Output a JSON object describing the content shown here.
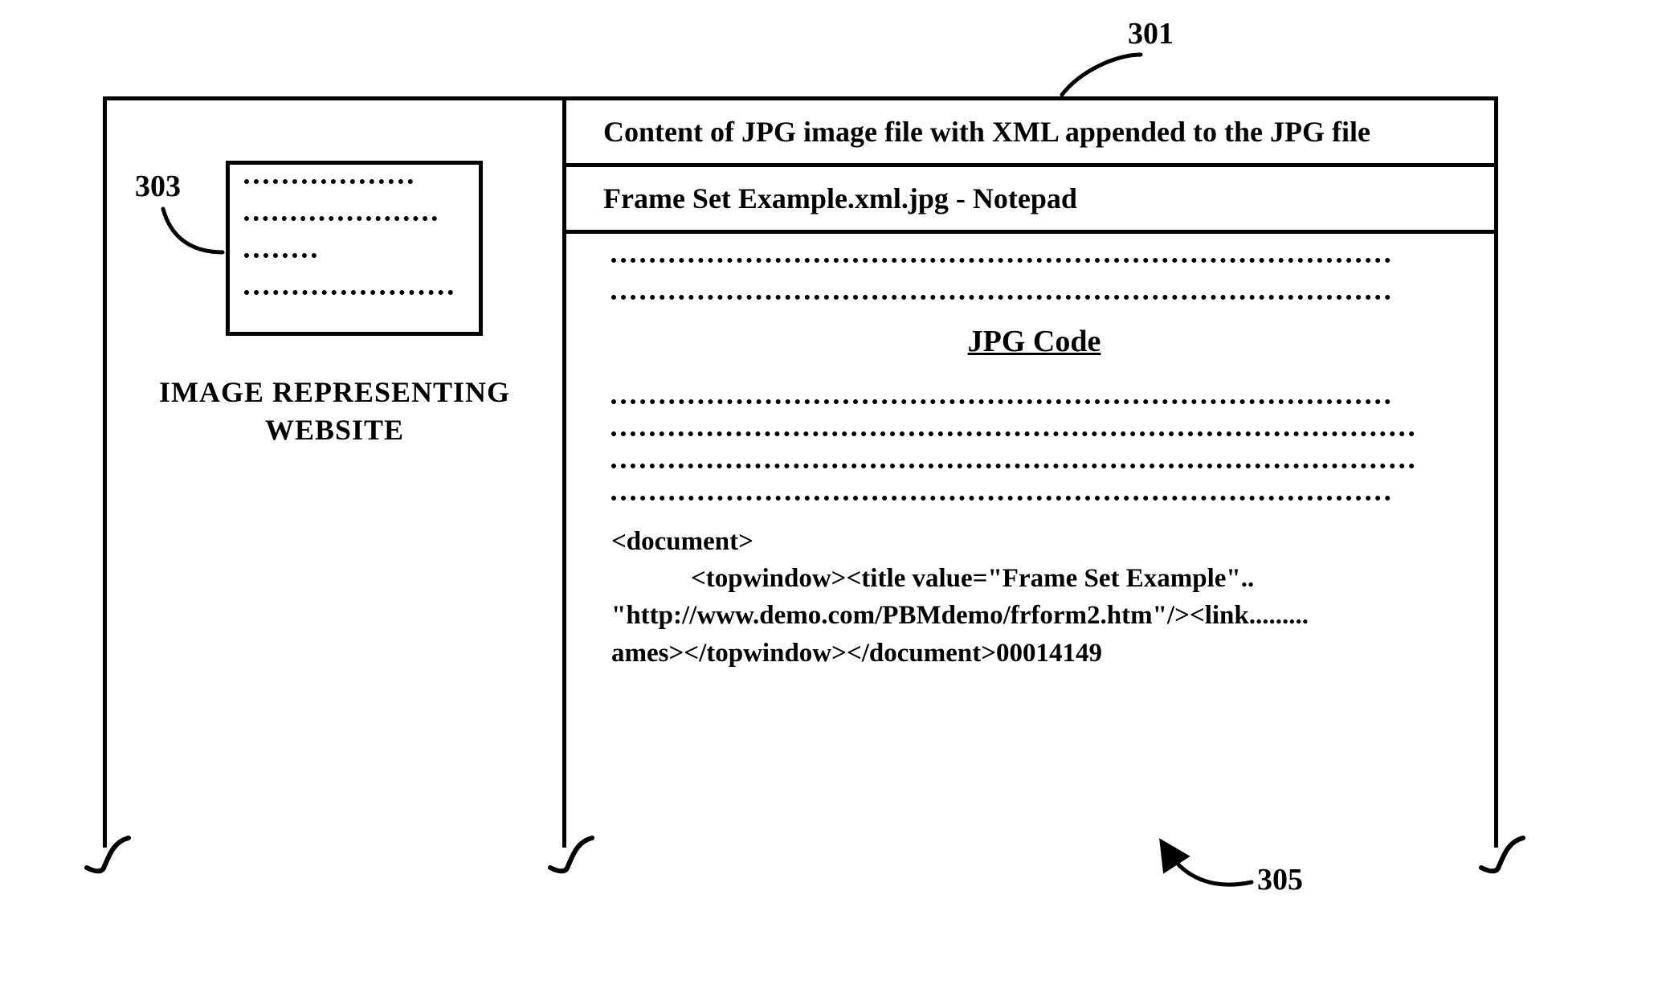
{
  "refs": {
    "r301": "301",
    "r303": "303",
    "r305": "305"
  },
  "left": {
    "caption_line1": "IMAGE REPRESENTING",
    "caption_line2": "WEBSITE"
  },
  "right": {
    "header1": "Content of JPG image file with XML appended to the JPG file",
    "header2": "Frame Set Example.xml.jpg  - Notepad",
    "jpg_code_label": "JPG Code",
    "xml_line1": "<document>",
    "xml_line2": "            <topwindow><title value=\"Frame Set Example\"..",
    "xml_line3": "\"http://www.demo.com/PBMdemo/frform2.htm\"/><link.........",
    "xml_line4": "ames></topwindow></document>00014149"
  }
}
